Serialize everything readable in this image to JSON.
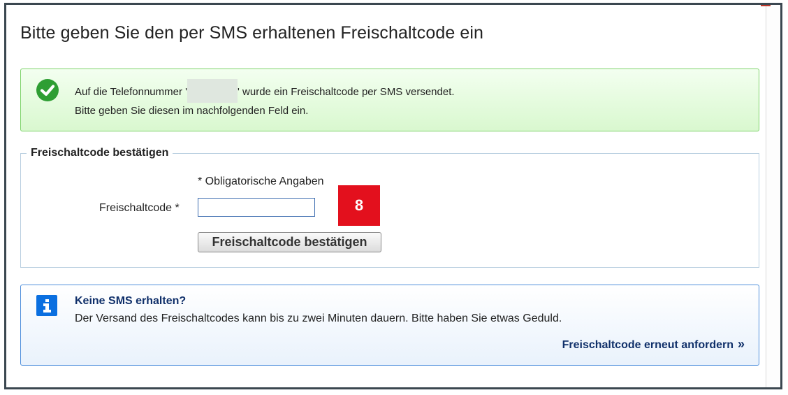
{
  "page": {
    "title": "Bitte geben Sie den per SMS erhaltenen Freischaltcode ein"
  },
  "success": {
    "icon": "check-circle-icon",
    "line1_before": "Auf die Telefonnummer '",
    "line1_after": "' wurde ein Freischaltcode per SMS versendet.",
    "line2": "Bitte geben Sie diesen im nachfolgenden Feld ein."
  },
  "confirm": {
    "legend": "Freischaltcode bestätigen",
    "required_note": "* Obligatorische Angaben",
    "field_label": "Freischaltcode *",
    "input_value": "",
    "button_label": "Freischaltcode bestätigen",
    "step_badge": "8"
  },
  "info": {
    "icon": "info-icon",
    "title": "Keine SMS erhalten?",
    "text": "Der Versand des Freischaltcodes kann bis zu zwei Minuten dauern. Bitte haben Sie etwas Geduld.",
    "link_label": "Freischaltcode erneut anfordern",
    "link_icon": "double-chevron-right-icon"
  },
  "colors": {
    "success_border": "#7ed36b",
    "success_icon": "#2e9e33",
    "info_border": "#4f8fdc",
    "info_icon": "#0a6fe0",
    "badge": "#e3101d",
    "link": "#10306a"
  }
}
